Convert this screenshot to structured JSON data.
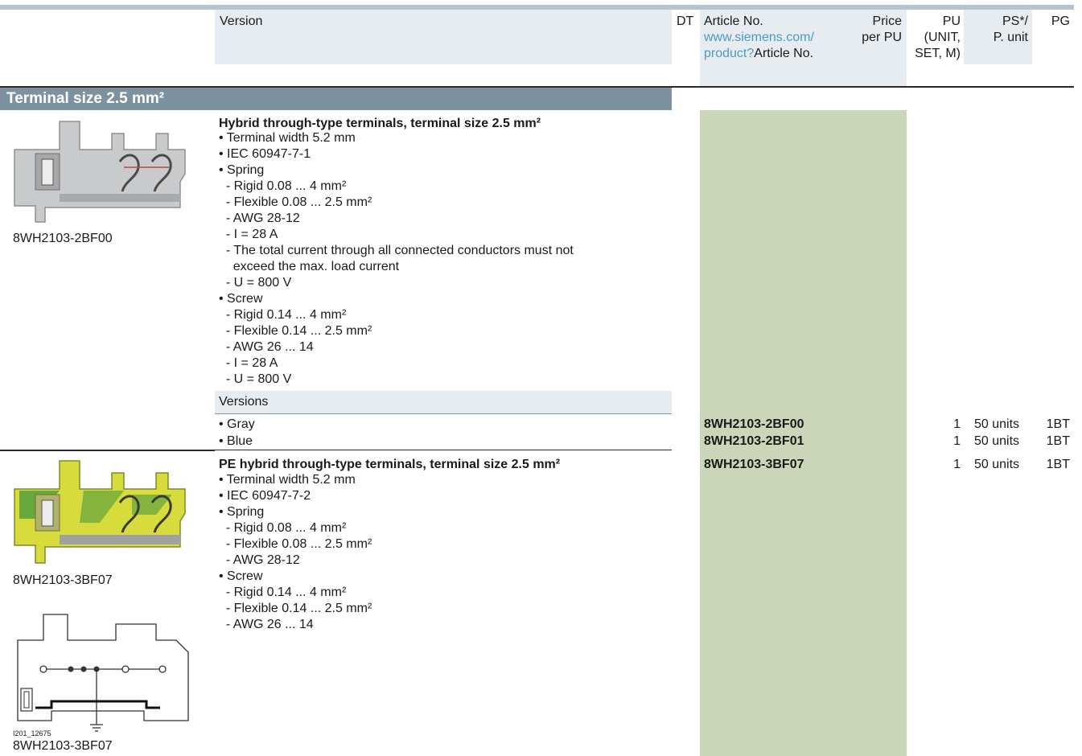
{
  "header": {
    "version": "Version",
    "dt": "DT",
    "article_no": "Article No.",
    "article_link_1": "www.siemens.com/",
    "article_link_2": "product?",
    "article_link_3": "Article No.",
    "price_1": "Price",
    "price_2": "per PU",
    "pu_1": "PU",
    "pu_2": "(UNIT,",
    "pu_3": "SET, M)",
    "ps_1": "PS*/",
    "ps_2": "P. unit",
    "pg": "PG"
  },
  "section": {
    "title": "Terminal size 2.5 mm²"
  },
  "product1": {
    "caption": "8WH2103-2BF00",
    "title": "Hybrid through-type terminals, terminal size 2.5 mm²",
    "lines": [
      "• Terminal width 5.2 mm",
      "• IEC 60947-7-1",
      "• Spring",
      "  - Rigid 0.08 ... 4 mm²",
      "  - Flexible 0.08 ... 2.5 mm²",
      "  - AWG 28-12",
      "  - I = 28 A",
      "  - The total current through all connected conductors must not",
      "    exceed the max. load current",
      "  - U = 800 V",
      "• Screw",
      "  - Rigid 0.14 ... 4 mm²",
      "  - Flexible 0.14 ... 2.5 mm²",
      "  - AWG 26 ... 14",
      "  - I = 28 A",
      "  - U = 800 V"
    ],
    "versions_label": "Versions",
    "rows": [
      {
        "version": "• Gray",
        "article": "8WH2103-2BF00",
        "pu": "1",
        "ps": "50 units",
        "pg": "1BT"
      },
      {
        "version": "• Blue",
        "article": "8WH2103-2BF01",
        "pu": "1",
        "ps": "50 units",
        "pg": "1BT"
      }
    ]
  },
  "product2": {
    "caption": "8WH2103-3BF07",
    "title": "PE hybrid through-type terminals, terminal size 2.5 mm²",
    "lines": [
      "• Terminal width 5.2 mm",
      "• IEC 60947-7-2",
      "• Spring",
      "  - Rigid 0.08 ... 4 mm²",
      "  - Flexible 0.08 ... 2.5 mm²",
      "  - AWG 28-12",
      "• Screw",
      "  - Rigid 0.14 ... 4 mm²",
      "  - Flexible 0.14 ... 2.5 mm²",
      "  - AWG 26 ... 14"
    ],
    "row": {
      "article": "8WH2103-3BF07",
      "pu": "1",
      "ps": "50 units",
      "pg": "1BT"
    },
    "diagram_id": "I201_12675",
    "diagram_caption": "8WH2103-3BF07"
  },
  "colors": {
    "header_bg": "#e6ecf0",
    "section_bar": "#7d92a1",
    "article_column": "#cbd5b8",
    "link": "#4d99c9"
  }
}
